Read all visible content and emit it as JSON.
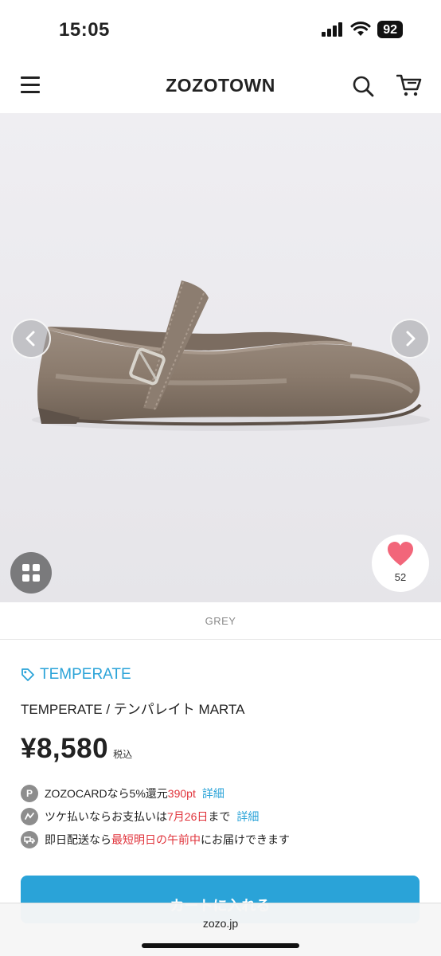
{
  "status_bar": {
    "time": "15:05",
    "battery": "92"
  },
  "header": {
    "logo": "ZOZOTOWN"
  },
  "product": {
    "favorite_count": "52",
    "color": "GREY",
    "brand": "TEMPERATE",
    "name": "TEMPERATE / テンパレイト MARTA",
    "price": "¥8,580",
    "tax_label": "税込"
  },
  "info": {
    "card": {
      "icon": "P",
      "text1": "ZOZOCARDなら5%還元",
      "highlight": "390pt",
      "link": "詳細"
    },
    "tsuke": {
      "text1": "ツケ払いならお支払いは",
      "highlight": "7月26日",
      "text2": "まで",
      "link": "詳細"
    },
    "delivery": {
      "text1": "即日配送なら",
      "highlight": "最短明日の午前中",
      "text2": "にお届けできます"
    }
  },
  "cta": {
    "label": "カートに入れる"
  },
  "browser": {
    "url": "zozo.jp"
  },
  "colors": {
    "accent": "#2aa3d8",
    "highlight": "#e0323a",
    "heart": "#f2667a",
    "shoe": "#8a7b6d"
  }
}
